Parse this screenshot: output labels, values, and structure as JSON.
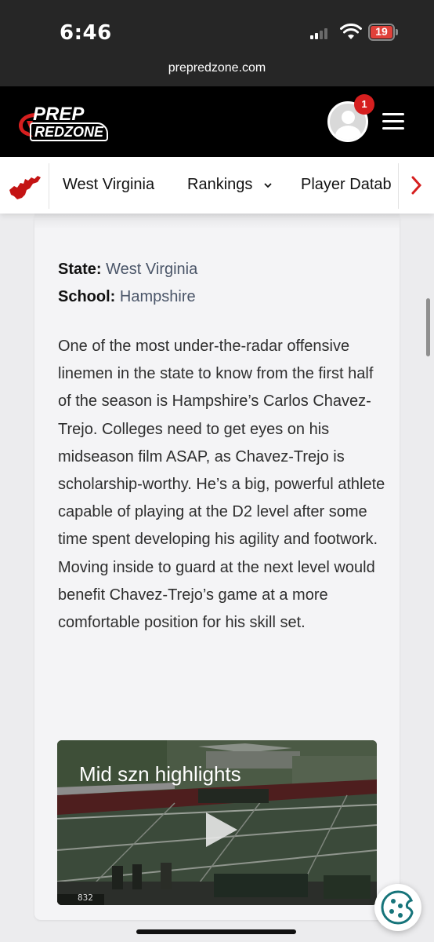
{
  "status_bar": {
    "time": "6:46",
    "battery_level": "19",
    "battery_color": "#e0413a"
  },
  "browser": {
    "url": "prepredzone.com"
  },
  "header": {
    "logo_top": "PREP",
    "logo_bottom": "REDZONE",
    "notification_count": "1",
    "accent_color": "#d61f1f"
  },
  "sub_nav": {
    "state_label": "West Virginia",
    "rankings_label": "Rankings",
    "player_database_label": "Player Datab",
    "next_icon": "chevron-right-icon"
  },
  "profile": {
    "state_key": "State:",
    "state_value": "West Virginia",
    "school_key": "School:",
    "school_value": "Hampshire"
  },
  "article": {
    "body": "One of the most under-the-radar offensive linemen in the state to know from the first half of the season is Hampshire’s Carlos Chavez-Trejo. Colleges need to get eyes on his midseason film ASAP, as Chavez-Trejo is scholarship-worthy. He’s a big, powerful athlete capable of playing at the D2 level after some time spent developing his agility and footwork. Moving inside to guard at the next level would benefit Chavez-Trejo’s game at a more comfortable position for his skill set."
  },
  "video": {
    "title": "Mid szn highlights",
    "scoreboard_text": "832"
  },
  "icons": {
    "cookie": "cookie-icon",
    "play": "play-icon",
    "menu": "hamburger-menu-icon"
  }
}
